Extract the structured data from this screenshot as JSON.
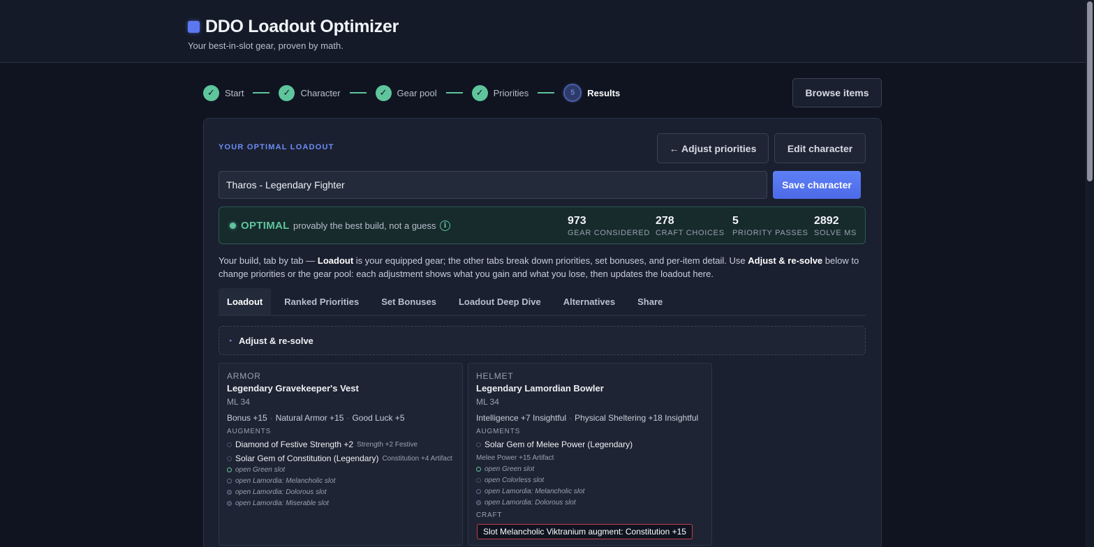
{
  "app": {
    "title": "DDO Loadout Optimizer",
    "tagline": "Your best-in-slot gear, proven by math.",
    "brand_color": "#5b78f0"
  },
  "stepper": {
    "steps": [
      {
        "label": "Start",
        "state": "done",
        "icon": "check-icon"
      },
      {
        "label": "Character",
        "state": "done",
        "icon": "check-icon"
      },
      {
        "label": "Gear pool",
        "state": "done",
        "icon": "check-icon"
      },
      {
        "label": "Priorities",
        "state": "done",
        "icon": "check-icon"
      },
      {
        "label": "Results",
        "state": "current",
        "number": "5"
      }
    ],
    "done_color": "#5fc59c"
  },
  "header_actions": {
    "browse_items": "Browse items"
  },
  "loadout": {
    "section_label": "YOUR OPTIMAL LOADOUT",
    "adjust_priorities": "← Adjust priorities",
    "edit_character": "Edit character",
    "character_name": "Tharos - Legendary Fighter",
    "save_character": "Save character"
  },
  "status": {
    "word": "OPTIMAL",
    "description": "provably the best build, not a guess",
    "info_icon": "info-icon",
    "color": "#5fc59c",
    "stats": [
      {
        "value": "973",
        "label": "GEAR CONSIDERED"
      },
      {
        "value": "278",
        "label": "CRAFT CHOICES"
      },
      {
        "value": "5",
        "label": "PRIORITY PASSES"
      },
      {
        "value": "2892",
        "label": "SOLVE MS"
      }
    ]
  },
  "description": {
    "part1": "Your build, tab by tab — ",
    "bold1": "Loadout",
    "part2": " is your equipped gear; the other tabs break down priorities, set bonuses, and per-item detail. Use ",
    "bold2": "Adjust & re-solve",
    "part3": " below to change priorities or the gear pool: each adjustment shows what you gain and what you lose, then updates the loadout here."
  },
  "tabs": [
    {
      "label": "Loadout",
      "active": true
    },
    {
      "label": "Ranked Priorities",
      "active": false
    },
    {
      "label": "Set Bonuses",
      "active": false
    },
    {
      "label": "Loadout Deep Dive",
      "active": false
    },
    {
      "label": "Alternatives",
      "active": false
    },
    {
      "label": "Share",
      "active": false
    }
  ],
  "adjust_panel": {
    "label": "Adjust & re-solve",
    "caret": "▸"
  },
  "items": [
    {
      "slot": "ARMOR",
      "name": "Legendary Gravekeeper's Vest",
      "ml": "ML 34",
      "stats": [
        "Bonus +15",
        "Natural Armor +15",
        "Good Luck +5"
      ],
      "augments_label": "AUGMENTS",
      "augments": [
        {
          "name": "Diamond of Festive Strength +2",
          "effect": "Strength +2 Festive"
        },
        {
          "name": "Solar Gem of Constitution (Legendary)",
          "effect": "Constitution +4 Artifact"
        }
      ],
      "open_slots": [
        "open Green slot",
        "open Lamordia: Melancholic slot",
        "open Lamordia: Dolorous slot",
        "open Lamordia: Miserable slot"
      ]
    },
    {
      "slot": "HELMET",
      "name": "Legendary Lamordian Bowler",
      "ml": "ML 34",
      "stats": [
        "Intelligence +7 Insightful",
        "Physical Sheltering +18 Insightful"
      ],
      "augments_label": "AUGMENTS",
      "augments": [
        {
          "name": "Solar Gem of Melee Power (Legendary)",
          "effect": "Melee Power +15 Artifact"
        }
      ],
      "open_slots": [
        "open Green slot",
        "open Colorless slot",
        "open Lamordia: Melancholic slot",
        "open Lamordia: Dolorous slot"
      ],
      "craft_label": "CRAFT",
      "craft": "Slot Melancholic Viktranium augment: Constitution +15"
    }
  ]
}
